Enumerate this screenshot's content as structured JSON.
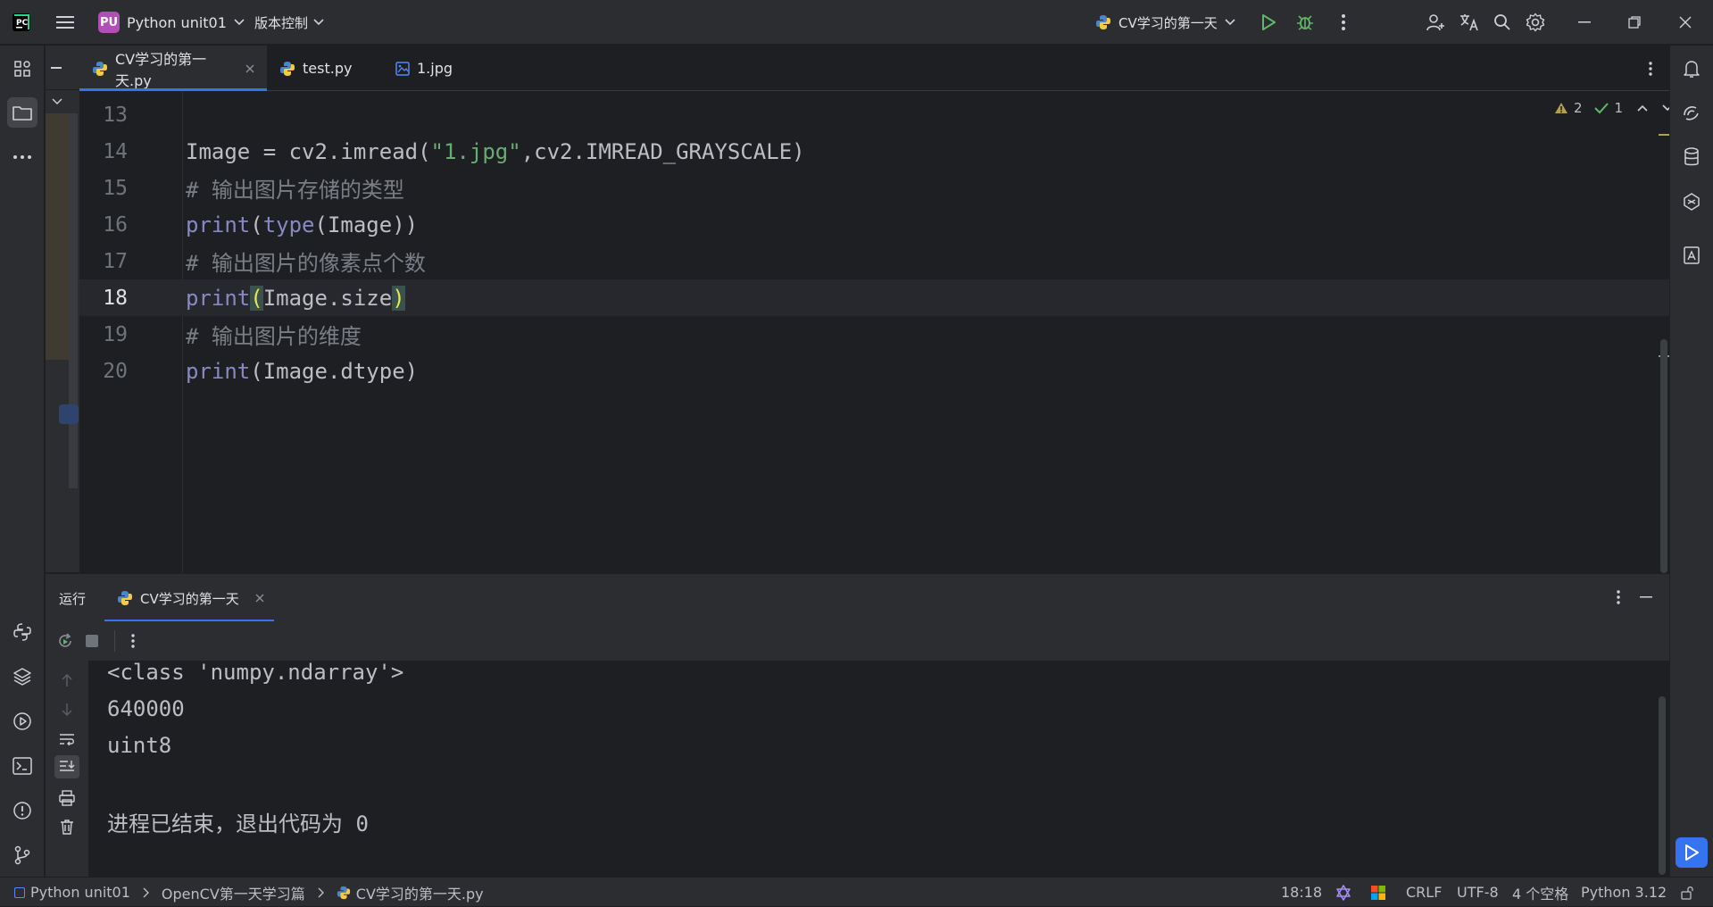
{
  "titlebar": {
    "project_badge": "PU",
    "project_name": "Python unit01",
    "vcs_label": "版本控制",
    "run_config": "CV学习的第一天"
  },
  "editor_tabs": [
    {
      "label": "CV学习的第一天.py",
      "active": true
    },
    {
      "label": "test.py",
      "active": false
    },
    {
      "label": "1.jpg",
      "active": false
    }
  ],
  "inspections": {
    "warnings": "2",
    "ok": "1"
  },
  "code_lines": [
    {
      "num": "13",
      "text": ""
    },
    {
      "num": "14",
      "text": "Image = cv2.imread(\"1.jpg\",cv2.IMREAD_GRAYSCALE)"
    },
    {
      "num": "15",
      "text": "# 输出图片存储的类型"
    },
    {
      "num": "16",
      "text": "print(type(Image))"
    },
    {
      "num": "17",
      "text": "# 输出图片的像素点个数"
    },
    {
      "num": "18",
      "text": "print(Image.size)"
    },
    {
      "num": "19",
      "text": "# 输出图片的维度"
    },
    {
      "num": "20",
      "text": "print(Image.dtype)"
    }
  ],
  "run": {
    "title": "运行",
    "tab_label": "CV学习的第一天",
    "output": [
      "<class 'numpy.ndarray'>",
      "640000",
      "uint8",
      "",
      "进程已结束，退出代码为 0"
    ]
  },
  "statusbar": {
    "breadcrumb": [
      "Python unit01",
      "OpenCV第一天学习篇",
      "CV学习的第一天.py"
    ],
    "position": "18:18",
    "line_sep": "CRLF",
    "encoding": "UTF-8",
    "indent": "4 个空格",
    "interpreter": "Python 3.12"
  },
  "colors": {
    "accent": "#3574f0",
    "keyword": "#8888c6",
    "string": "#6aab73",
    "comment": "#7a7e85",
    "run_green": "#5fb865"
  }
}
